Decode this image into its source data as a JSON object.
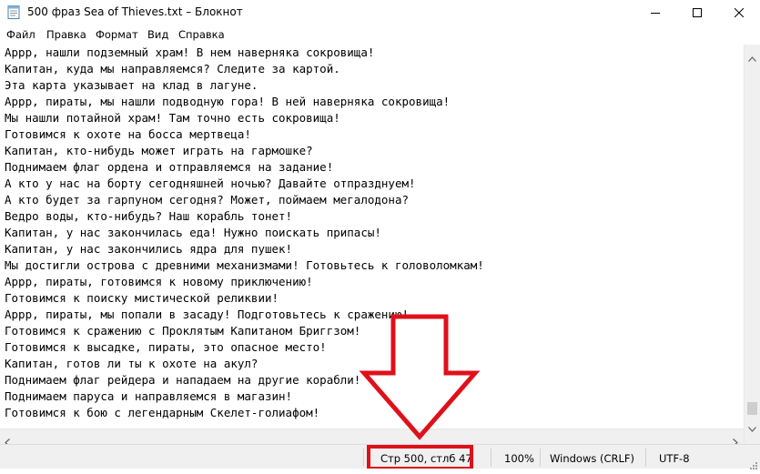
{
  "window": {
    "title": "500 фраз  Sea of Thieves.txt – Блокнот"
  },
  "menu": [
    "Файл",
    "Правка",
    "Формат",
    "Вид",
    "Справка"
  ],
  "editor": {
    "lines": [
      "Аррр, нашли подземный храм! В нем наверняка сокровища!",
      "Капитан, куда мы направляемся? Следите за картой.",
      "Эта карта указывает на клад в лагуне.",
      "Аррр, пираты, мы нашли подводную гора! В ней наверняка сокровища!",
      "Мы нашли потайной храм! Там точно есть сокровища!",
      "Готовимся к охоте на босса мертвеца!",
      "Капитан, кто-нибудь может играть на гармошке?",
      "Поднимаем флаг ордена и отправляемся на задание!",
      "А кто у нас на борту сегодняшней ночью? Давайте отпразднуем!",
      "А кто будет за гарпуном сегодня? Может, поймаем мегалодона?",
      "Ведро воды, кто-нибудь? Наш корабль тонет!",
      "Капитан, у нас закончилась еда! Нужно поискать припасы!",
      "Капитан, у нас закончились ядра для пушек!",
      "Мы достигли острова с древними механизмами! Готовьтесь к головоломкам!",
      "Аррр, пираты, готовимся к новому приключению!",
      "Готовимся к поиску мистической реликвии!",
      "Аррр, пираты, мы попали в засаду! Подготовьтесь к сражению!",
      "Готовимся к сражению с Проклятым Капитаном Бриггзом!",
      "Готовимся к высадке, пираты, это опасное место!",
      "Капитан, готов ли ты к охоте на акул?",
      "Поднимаем флаг рейдера и нападаем на другие корабли!",
      "Поднимаем паруса и направляемся в магазин!",
      "Готовимся к бою с легендарным Скелет-голиафом!"
    ]
  },
  "status": {
    "position": "Стр 500, стлб 47",
    "zoom": "100%",
    "line_ending": "Windows (CRLF)",
    "encoding": "UTF-8"
  },
  "annotation": {
    "color": "#e0101a",
    "icons": [
      "highlight-box",
      "down-arrow"
    ]
  }
}
